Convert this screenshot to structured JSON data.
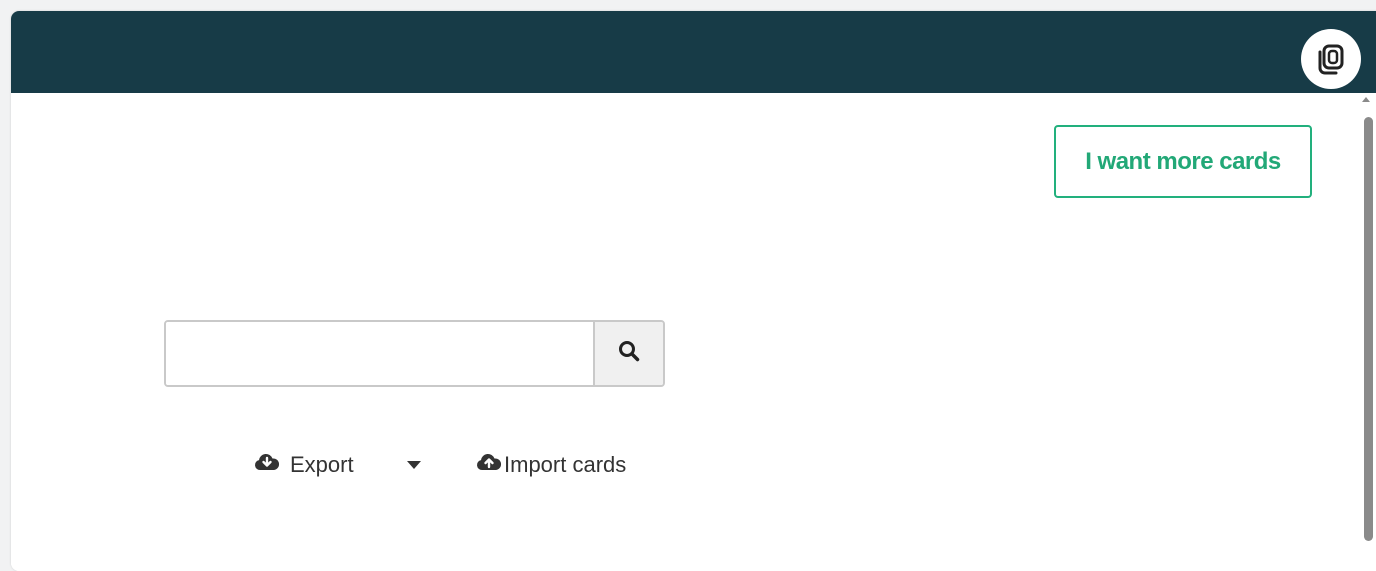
{
  "header": {
    "app_icon": "copy-cards-icon",
    "background_color": "#173b47"
  },
  "main": {
    "more_cards_label": "I want more cards",
    "accent_color": "#22b07d",
    "search": {
      "value": "",
      "placeholder": "",
      "button_icon": "search-icon"
    },
    "actions": {
      "export_label": "Export",
      "export_icon": "cloud-download-icon",
      "export_menu_icon": "caret-down-icon",
      "import_label": "Import cards",
      "import_icon": "cloud-upload-icon"
    }
  }
}
